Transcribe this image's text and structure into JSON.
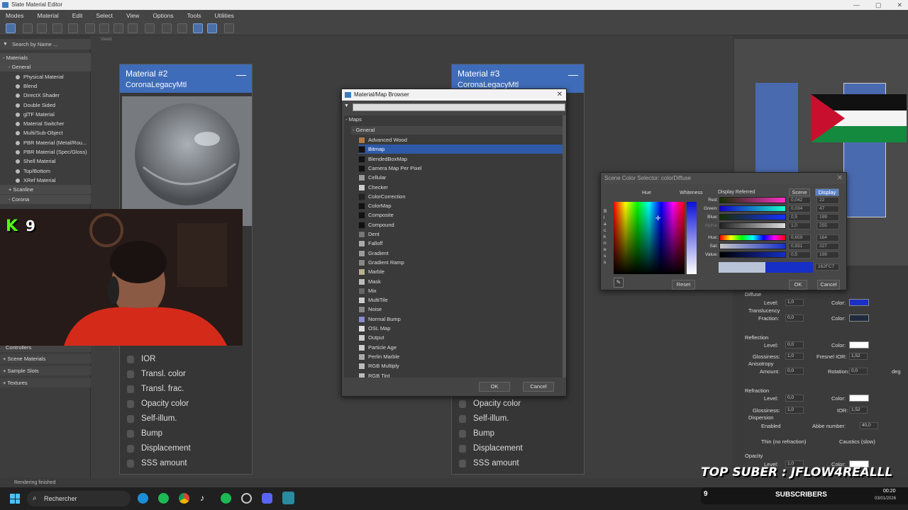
{
  "app": {
    "title": "Slate Material Editor"
  },
  "menu": [
    "Modes",
    "Material",
    "Edit",
    "Select",
    "View",
    "Options",
    "Tools",
    "Utilities"
  ],
  "left_panel": {
    "search_placeholder": "Search by Name ...",
    "items": [
      {
        "label": "- Materials",
        "type": "head"
      },
      {
        "label": "- General",
        "type": "sub"
      },
      {
        "label": "Physical Material",
        "type": "item"
      },
      {
        "label": "Blend",
        "type": "item"
      },
      {
        "label": "DirectX Shader",
        "type": "item"
      },
      {
        "label": "Double Sided",
        "type": "item"
      },
      {
        "label": "glTF Material",
        "type": "item"
      },
      {
        "label": "Material Switcher",
        "type": "item"
      },
      {
        "label": "Multi/Sub-Object",
        "type": "item"
      },
      {
        "label": "PBR Material (Metal/Rou...",
        "type": "item"
      },
      {
        "label": "PBR Material (Spec/Gloss)",
        "type": "item"
      },
      {
        "label": "Shell Material",
        "type": "item"
      },
      {
        "label": "Top/Bottom",
        "type": "item"
      },
      {
        "label": "XRef Material",
        "type": "item"
      },
      {
        "label": "+ Scanline",
        "type": "sub"
      },
      {
        "label": "- Corona",
        "type": "sub"
      }
    ],
    "bottom_items": [
      "Controllers",
      "+ Scene Materials",
      "+ Sample Slots",
      "+ Textures"
    ]
  },
  "view": {
    "label": "View1"
  },
  "node1": {
    "title": "Material #2",
    "subtitle": "CoronaLegacyMtl",
    "slots": [
      "IOR",
      "Transl. color",
      "Transl. frac.",
      "Opacity color",
      "Self-illum.",
      "Bump",
      "Displacement",
      "SSS amount"
    ]
  },
  "node2": {
    "title": "Material #3",
    "subtitle": "CoronaLegacyMtl",
    "slots": [
      "Opacity color",
      "Self-illum.",
      "Bump",
      "Displacement",
      "SSS amount"
    ]
  },
  "map_browser": {
    "title": "Material/Map Browser",
    "group": "- Maps",
    "subgroup": "- General",
    "items": [
      "Advanced Wood",
      "Bitmap",
      "BlendedBoxMap",
      "Camera Map Per Pixel",
      "Cellular",
      "Checker",
      "ColorCorrection",
      "ColorMap",
      "Composite",
      "Compound",
      "Dent",
      "Falloff",
      "Gradient",
      "Gradient Ramp",
      "Marble",
      "Mask",
      "Mix",
      "MultiTile",
      "Noise",
      "Normal Bump",
      "OSL Map",
      "Output",
      "Particle Age",
      "Perlin Marble",
      "RGB Multiply",
      "RGB Tint"
    ],
    "selected": "Bitmap",
    "ok": "OK",
    "cancel": "Cancel"
  },
  "color_selector": {
    "title": "Scene Color Selector: colorDiffuse",
    "hue_label": "Hue",
    "whiteness_label": "Whiteness",
    "blackness_letters": "B l a c k n e s s",
    "display_referred": "Display Referred",
    "tab_scene": "Scene",
    "tab_display": "Display",
    "rows": [
      {
        "label": "Red:",
        "value": "0,042",
        "int": "22"
      },
      {
        "label": "Green:",
        "value": "0,034",
        "int": "47"
      },
      {
        "label": "Blue:",
        "value": "0,5",
        "int": "199"
      },
      {
        "label": "Alpha:",
        "value": "1,0",
        "int": "255"
      },
      {
        "label": "Hue:",
        "value": "0,659",
        "int": "164"
      },
      {
        "label": "Sat:",
        "value": "0,931",
        "int": "227"
      },
      {
        "label": "Value:",
        "value": "0,5",
        "int": "199"
      }
    ],
    "hex": "162FC7",
    "reset": "Reset",
    "ok": "OK",
    "cancel": "Cancel",
    "new_color": "#162fc7",
    "old_color": "#b9c3d8"
  },
  "right_panel": {
    "diffuse": {
      "title": "Diffuse",
      "level_label": "Level:",
      "level": "1,0",
      "color_label": "Color:",
      "color": "#1a2fc8"
    },
    "translucency": {
      "title": "Translucency",
      "fraction_label": "Fraction:",
      "fraction": "0,0",
      "color_label": "Color:",
      "color": "#1f2a3d"
    },
    "reflection": {
      "title": "Reflection",
      "level_label": "Level:",
      "level": "0,0",
      "color_label": "Color:",
      "glossiness_label": "Glossiness:",
      "glossiness": "1,0",
      "fresnel_label": "Fresnel IOR:",
      "fresnel": "1,52"
    },
    "anisotropy": {
      "title": "Anisotropy",
      "amount_label": "Amount:",
      "amount": "0,0",
      "rotation_label": "Rotation:",
      "rotation": "0,0",
      "deg": "deg"
    },
    "refraction": {
      "title": "Refraction",
      "level_label": "Level:",
      "level": "0,0",
      "color_label": "Color:",
      "glossiness_label": "Glossiness:",
      "glossiness": "1,0",
      "ior_label": "IOR:",
      "ior": "1,52"
    },
    "dispersion": {
      "title": "Dispersion",
      "enabled": "Enabled",
      "abbe_label": "Abbe number:",
      "abbe": "40,0"
    },
    "thin": "Thin (no refraction)",
    "caustics": "Caustics (slow)",
    "opacity": {
      "title": "Opacity",
      "level_label": "Level:",
      "level": "1,0",
      "color_label": "Color:"
    }
  },
  "status": {
    "text": "Rendering finished"
  },
  "overlay": {
    "kick_count": "9",
    "top_suber": "TOP SUBER : JFLOW4REALLL",
    "sub_count": "9",
    "sub_label": "SUBSCRIBERS",
    "time": "00:20",
    "date": "03/01/2026"
  },
  "taskbar": {
    "search_placeholder": "Rechercher"
  },
  "colors": {
    "accent": "#3f6cb8",
    "selection": "#2e5aa8",
    "kick_green": "#53fc18"
  }
}
